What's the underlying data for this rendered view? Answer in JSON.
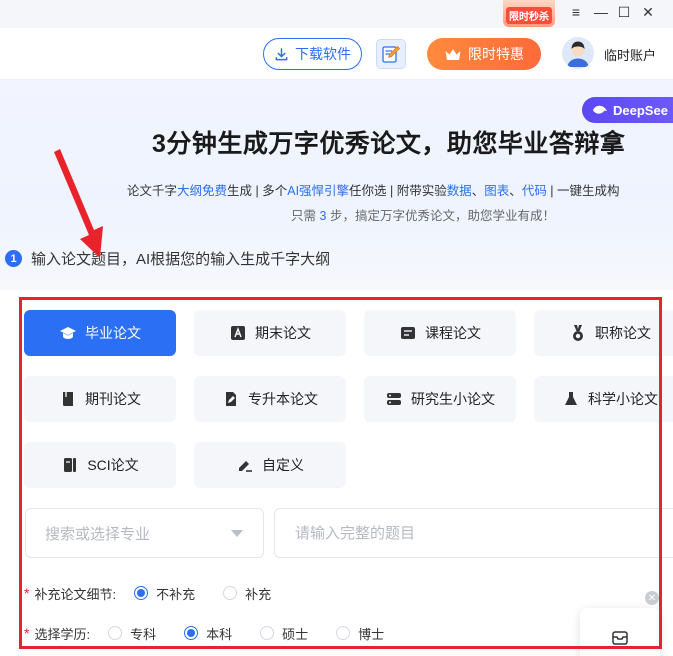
{
  "titlebar": {
    "promo_label": "限时秒杀",
    "controls": [
      "≡",
      "—",
      "☐",
      "✕"
    ]
  },
  "header": {
    "download_label": "下载软件",
    "vip_label": "限时特惠",
    "user_name": "临时账户"
  },
  "hero": {
    "badge": "DeepSee",
    "title": "3分钟生成万字优秀论文，助您毕业答辩拿",
    "sub_parts": [
      {
        "t": "论文千字",
        "hl": false
      },
      {
        "t": "大纲免费",
        "hl": true
      },
      {
        "t": "生成 | 多个",
        "hl": false
      },
      {
        "t": "AI强悍引擎",
        "hl": true
      },
      {
        "t": "任你选 | 附带实验",
        "hl": false
      },
      {
        "t": "数据",
        "hl": true
      },
      {
        "t": "、",
        "hl": false
      },
      {
        "t": "图表",
        "hl": true
      },
      {
        "t": "、",
        "hl": false
      },
      {
        "t": "代码",
        "hl": true
      },
      {
        "t": " | 一键生成构",
        "hl": false
      }
    ],
    "sub2_before": "只需",
    "sub2_num": "3",
    "sub2_after": "步，搞定万字优秀论文，助您学业有成！",
    "step_number": "1",
    "step_text": "输入论文题目，AI根据您的输入生成千字大纲"
  },
  "paper_types": [
    {
      "label": "毕业论文",
      "icon": "graduation-cap-icon",
      "active": true
    },
    {
      "label": "期末论文",
      "icon": "letter-a-icon",
      "active": false
    },
    {
      "label": "课程论文",
      "icon": "card-icon",
      "active": false
    },
    {
      "label": "职称论文",
      "icon": "medal-icon",
      "active": false
    },
    {
      "label": "期刊论文",
      "icon": "book-icon",
      "active": false
    },
    {
      "label": "专升本论文",
      "icon": "file-edit-icon",
      "active": false
    },
    {
      "label": "研究生小论文",
      "icon": "server-icon",
      "active": false
    },
    {
      "label": "科学小论文",
      "icon": "flask-icon",
      "active": false
    },
    {
      "label": "SCI论文",
      "icon": "sci-doc-icon",
      "active": false
    },
    {
      "label": "自定义",
      "icon": "pencil-line-icon",
      "active": false
    }
  ],
  "form": {
    "major_placeholder": "搜索或选择专业",
    "topic_placeholder": "请输入完整的题目",
    "detail_label": "补充论文细节:",
    "detail_options": [
      {
        "label": "不补充",
        "selected": true
      },
      {
        "label": "补充",
        "selected": false
      }
    ],
    "education_label": "选择学历:",
    "education_options": [
      {
        "label": "专科",
        "selected": false
      },
      {
        "label": "本科",
        "selected": true
      },
      {
        "label": "硕士",
        "selected": false
      },
      {
        "label": "博士",
        "selected": false
      }
    ]
  },
  "colors": {
    "accent": "#2b6ff5",
    "vip": "#ff7a3a",
    "annotation_red": "#e8232b",
    "deepseek": "#5b48f0"
  }
}
